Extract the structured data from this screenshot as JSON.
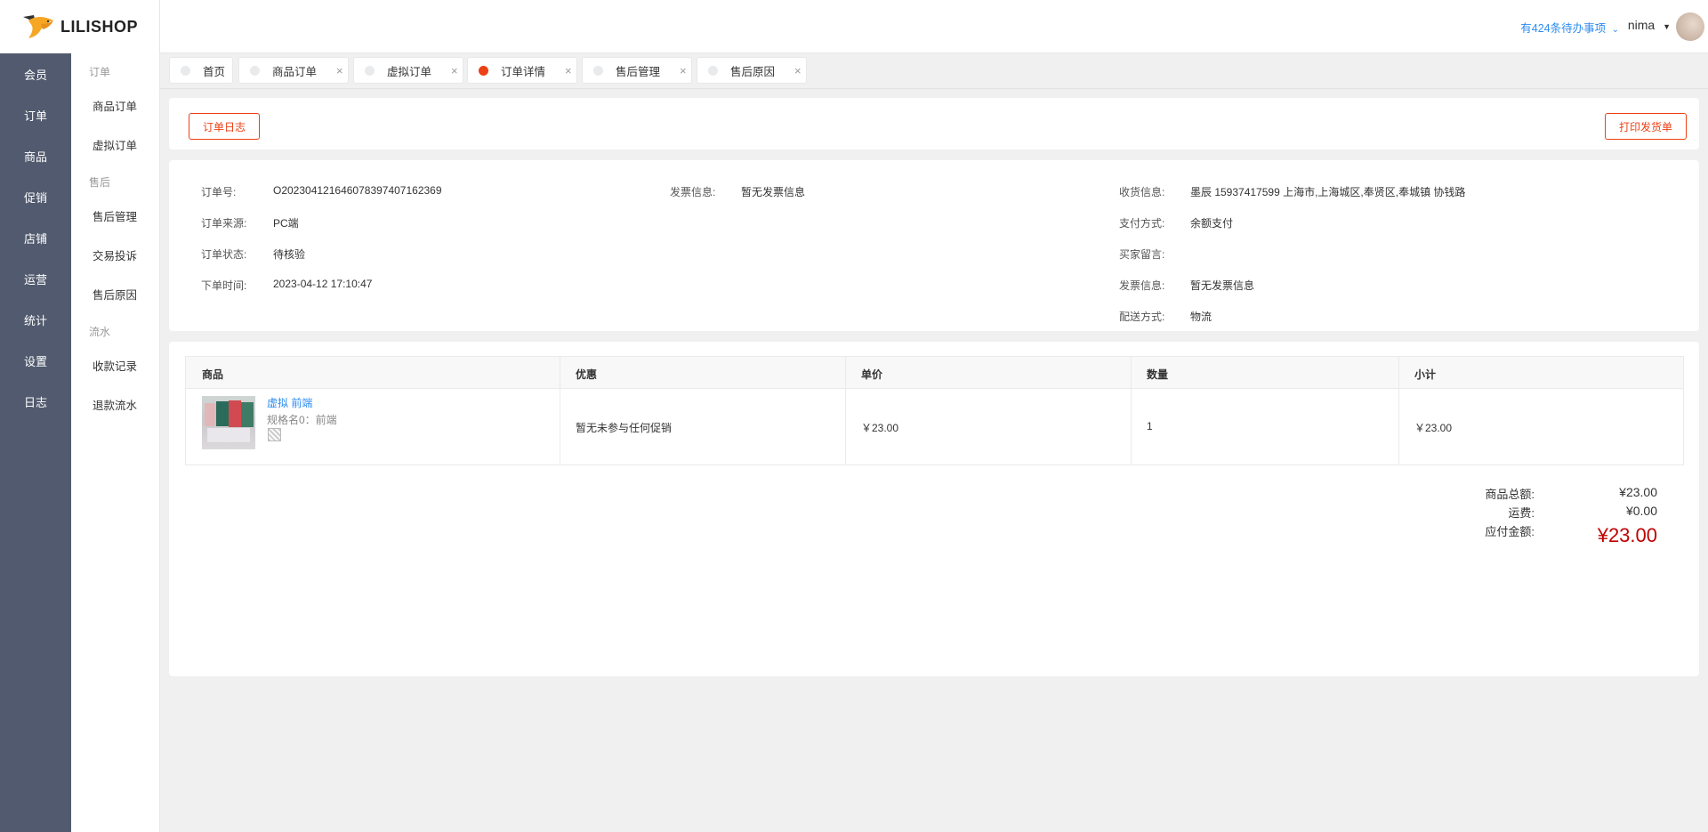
{
  "app": {
    "logo_text": "LILISHOP"
  },
  "header": {
    "todo": "有424条待办事项",
    "username": "nima"
  },
  "sidebar_primary": [
    {
      "label": "会员"
    },
    {
      "label": "订单"
    },
    {
      "label": "商品"
    },
    {
      "label": "促销"
    },
    {
      "label": "店铺"
    },
    {
      "label": "运营"
    },
    {
      "label": "统计"
    },
    {
      "label": "设置"
    },
    {
      "label": "日志"
    }
  ],
  "sidebar_secondary": {
    "group_order": "订单",
    "goods_order": "商品订单",
    "virtual_order": "虚拟订单",
    "group_after": "售后",
    "after_manage": "售后管理",
    "complaint": "交易投诉",
    "after_reason": "售后原因",
    "group_flow": "流水",
    "receipts": "收款记录",
    "refunds": "退款流水"
  },
  "tabs": [
    {
      "label": "首页"
    },
    {
      "label": "商品订单",
      "close": "×"
    },
    {
      "label": "虚拟订单",
      "close": "×"
    },
    {
      "label": "订单详情",
      "close": "×"
    },
    {
      "label": "售后管理",
      "close": "×"
    },
    {
      "label": "售后原因",
      "close": "×"
    }
  ],
  "actions": {
    "order_log": "订单日志",
    "print_invoice": "打印发货单"
  },
  "order_info": {
    "order_no_label": "订单号:",
    "order_no": "O202304121646078397407162369",
    "source_label": "订单来源:",
    "source": "PC端",
    "status_label": "订单状态:",
    "status": "待核验",
    "time_label": "下单时间:",
    "time": "2023-04-12 17:10:47",
    "invoice_label": "发票信息:",
    "invoice": "暂无发票信息",
    "receiver_label": "收货信息:",
    "receiver": "墨辰 15937417599 上海市,上海城区,奉贤区,奉城镇 协钱路",
    "pay_label": "支付方式:",
    "pay": "余额支付",
    "remark_label": "买家留言:",
    "remark": "",
    "invoice2_label": "发票信息:",
    "invoice2": "暂无发票信息",
    "delivery_label": "配送方式:",
    "delivery": "物流"
  },
  "table": {
    "headers": {
      "goods": "商品",
      "promo": "优惠",
      "price": "单价",
      "qty": "数量",
      "subtotal": "小计"
    },
    "rows": [
      {
        "name": "虚拟 前端",
        "spec": "规格名0：前端",
        "promo": "暂无未参与任何促销",
        "price": "￥23.00",
        "qty": "1",
        "subtotal": "￥23.00"
      }
    ]
  },
  "summary": {
    "goods_total_label": "商品总额:",
    "goods_total": "¥23.00",
    "freight_label": "运费:",
    "freight": "¥0.00",
    "payable_label": "应付金额:",
    "payable": "¥23.00"
  },
  "colors": {
    "accent": "#ed4014",
    "link": "#2d8cf0",
    "sidebar": "#515a6e",
    "price_red": "#c00000"
  }
}
